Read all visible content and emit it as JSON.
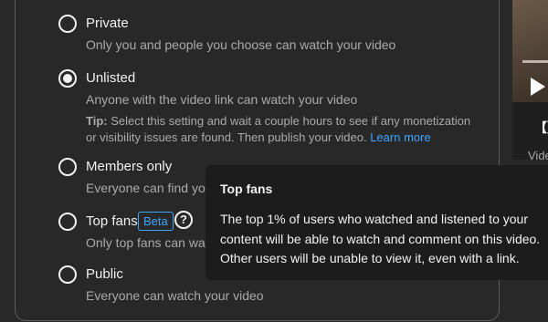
{
  "visibility": {
    "options": [
      {
        "label": "Private",
        "description": "Only you and people you choose can watch your video",
        "checked": false
      },
      {
        "label": "Unlisted",
        "description": "Anyone with the video link can watch your video",
        "checked": true,
        "tip_label": "Tip:",
        "tip_text": " Select this setting and wait a couple hours to see if any monetization or visibility issues are found. Then publish your video. ",
        "tip_link": "Learn more"
      },
      {
        "label": "Members only",
        "description": "Everyone can find your",
        "checked": false
      },
      {
        "label": "Top fans",
        "description": "Only top fans can watc",
        "checked": false,
        "badge": "Beta",
        "help": "?"
      },
      {
        "label": "Public",
        "description": "Everyone can watch your video",
        "checked": false
      }
    ]
  },
  "tooltip": {
    "title": "Top fans",
    "body": "The top 1% of users who watched and listened to your content will be able to watch and comment on this video. Other users will be unable to view it, even with a link."
  },
  "preview": {
    "icon": "play-icon",
    "badge_text": "【】",
    "caption": "Vide"
  },
  "colors": {
    "background": "#282828",
    "link": "#3ea6ff",
    "text": "#f1f1f1",
    "muted": "#aaaaaa",
    "tooltip": "#1c1c1c"
  }
}
